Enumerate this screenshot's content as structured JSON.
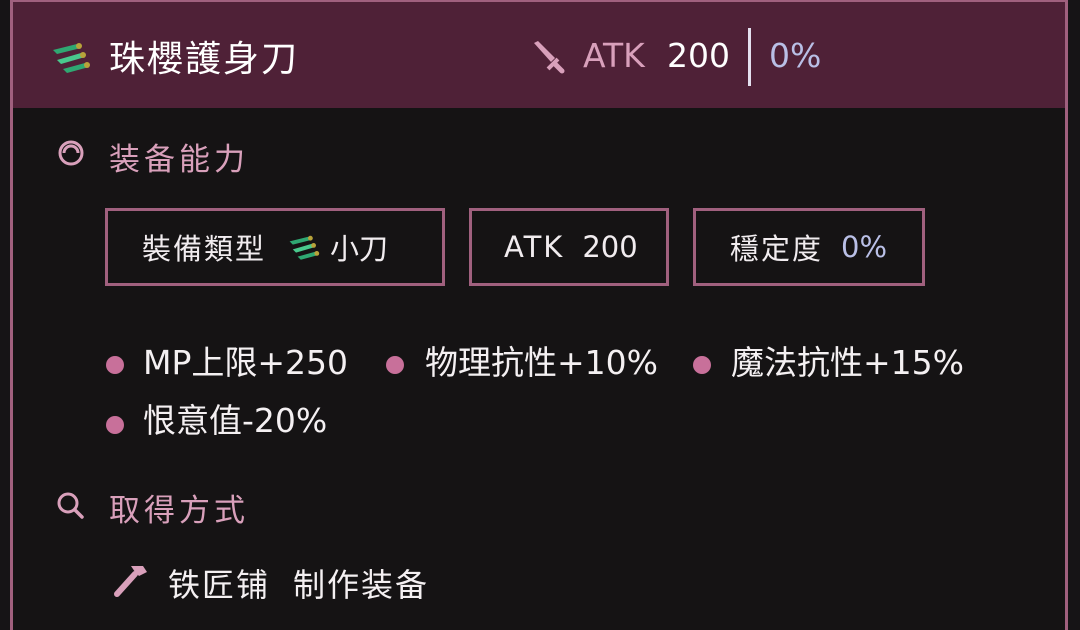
{
  "header": {
    "item_name": "珠櫻護身刀",
    "item_icon": "green-dagger-icon",
    "atk_icon": "sword-icon",
    "atk_label": "ATK",
    "atk_value": "200",
    "stability_value": "0%"
  },
  "equip_ability": {
    "icon": "swirl-icon",
    "title": "装备能力",
    "stats": [
      {
        "label": "裝備類型",
        "icon": "green-dagger-icon",
        "value": "小刀"
      },
      {
        "label": "ATK",
        "value": "200"
      },
      {
        "label": "穩定度",
        "value": "0%"
      }
    ],
    "effects": [
      "MP上限+250",
      "物理抗性+10%",
      "魔法抗性+15%",
      "恨意值-20%"
    ]
  },
  "acquisition": {
    "icon": "search-icon",
    "title": "取得方式",
    "source_icon": "hammer-icon",
    "source_place": "铁匠铺",
    "source_action": "制作装备"
  },
  "colors": {
    "header_bg": "#4f2137",
    "accent": "#a0607e",
    "label_pink": "#d9a0bb",
    "bullet": "#c8709a",
    "value_blue": "#b9bfe6",
    "body_bg": "#151314"
  }
}
